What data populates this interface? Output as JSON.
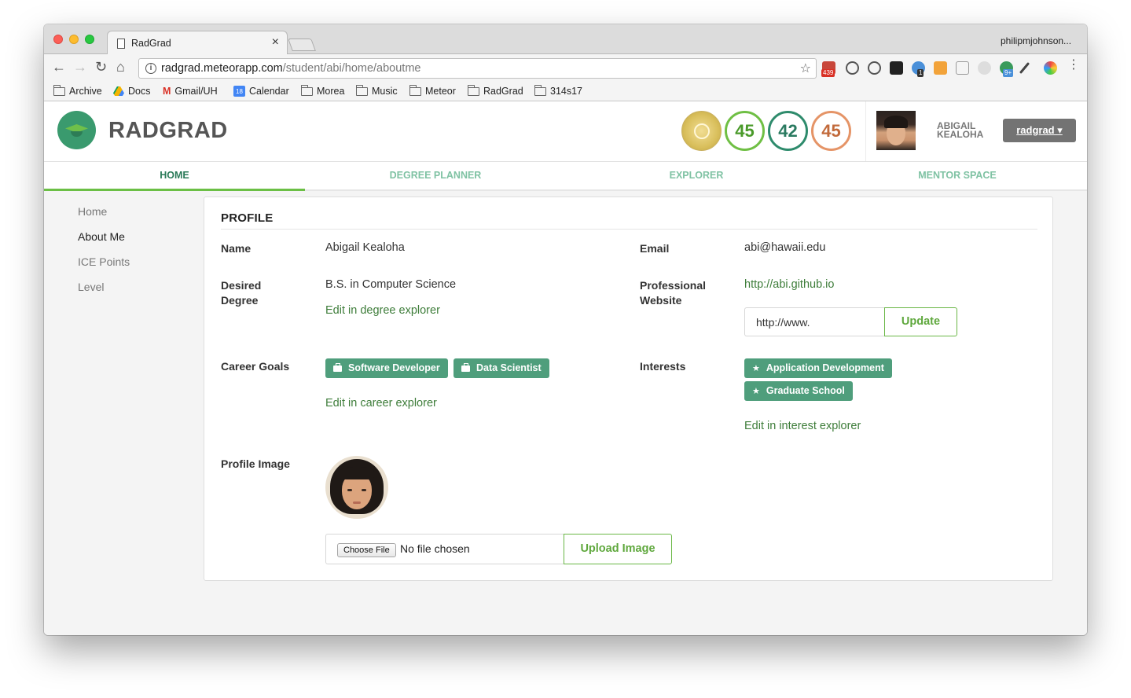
{
  "browser": {
    "tab_title": "RadGrad",
    "tab_close": "×",
    "profile_name": "philipmjohnson...",
    "url_host": "radgrad.meteorapp.com",
    "url_path": "/student/abi/home/aboutme",
    "extension_badges": [
      "439",
      "1",
      "9+"
    ],
    "bookmarks": [
      "Archive",
      "Docs",
      "Gmail/UH",
      "Calendar",
      "Morea",
      "Music",
      "Meteor",
      "RadGrad",
      "314s17"
    ],
    "calendar_day": "18"
  },
  "header": {
    "logo_text": "RADGRAD",
    "ice": {
      "innovation": "45",
      "competency": "42",
      "experience": "45"
    },
    "user_first": "ABIGAIL",
    "user_last": "KEALOHA",
    "account_button": "radgrad ▾"
  },
  "nav": {
    "tabs": [
      "HOME",
      "DEGREE PLANNER",
      "EXPLORER",
      "MENTOR SPACE"
    ]
  },
  "sidebar": {
    "items": [
      "Home",
      "About Me",
      "ICE Points",
      "Level"
    ]
  },
  "profile": {
    "title": "PROFILE",
    "name_label": "Name",
    "name_value": "Abigail Kealoha",
    "email_label": "Email",
    "email_value": "abi@hawaii.edu",
    "degree_label_1": "Desired",
    "degree_label_2": "Degree",
    "degree_value": "B.S. in Computer Science",
    "degree_link": "Edit in degree explorer",
    "website_label_1": "Professional",
    "website_label_2": "Website",
    "website_value": "http://abi.github.io",
    "website_input_value": "http://www.",
    "update_button": "Update",
    "career_label": "Career Goals",
    "career_goals": [
      "Software Developer",
      "Data Scientist"
    ],
    "career_link": "Edit in career explorer",
    "interests_label": "Interests",
    "interests": [
      "Application Development",
      "Graduate School"
    ],
    "interests_link": "Edit in interest explorer",
    "image_label": "Profile Image",
    "choose_file": "Choose File",
    "file_status": "No file chosen",
    "upload_button": "Upload Image"
  },
  "colors": {
    "accent_green": "#6bbf45",
    "chip_teal": "#4f9e7c",
    "link_green": "#3e7d3a"
  }
}
